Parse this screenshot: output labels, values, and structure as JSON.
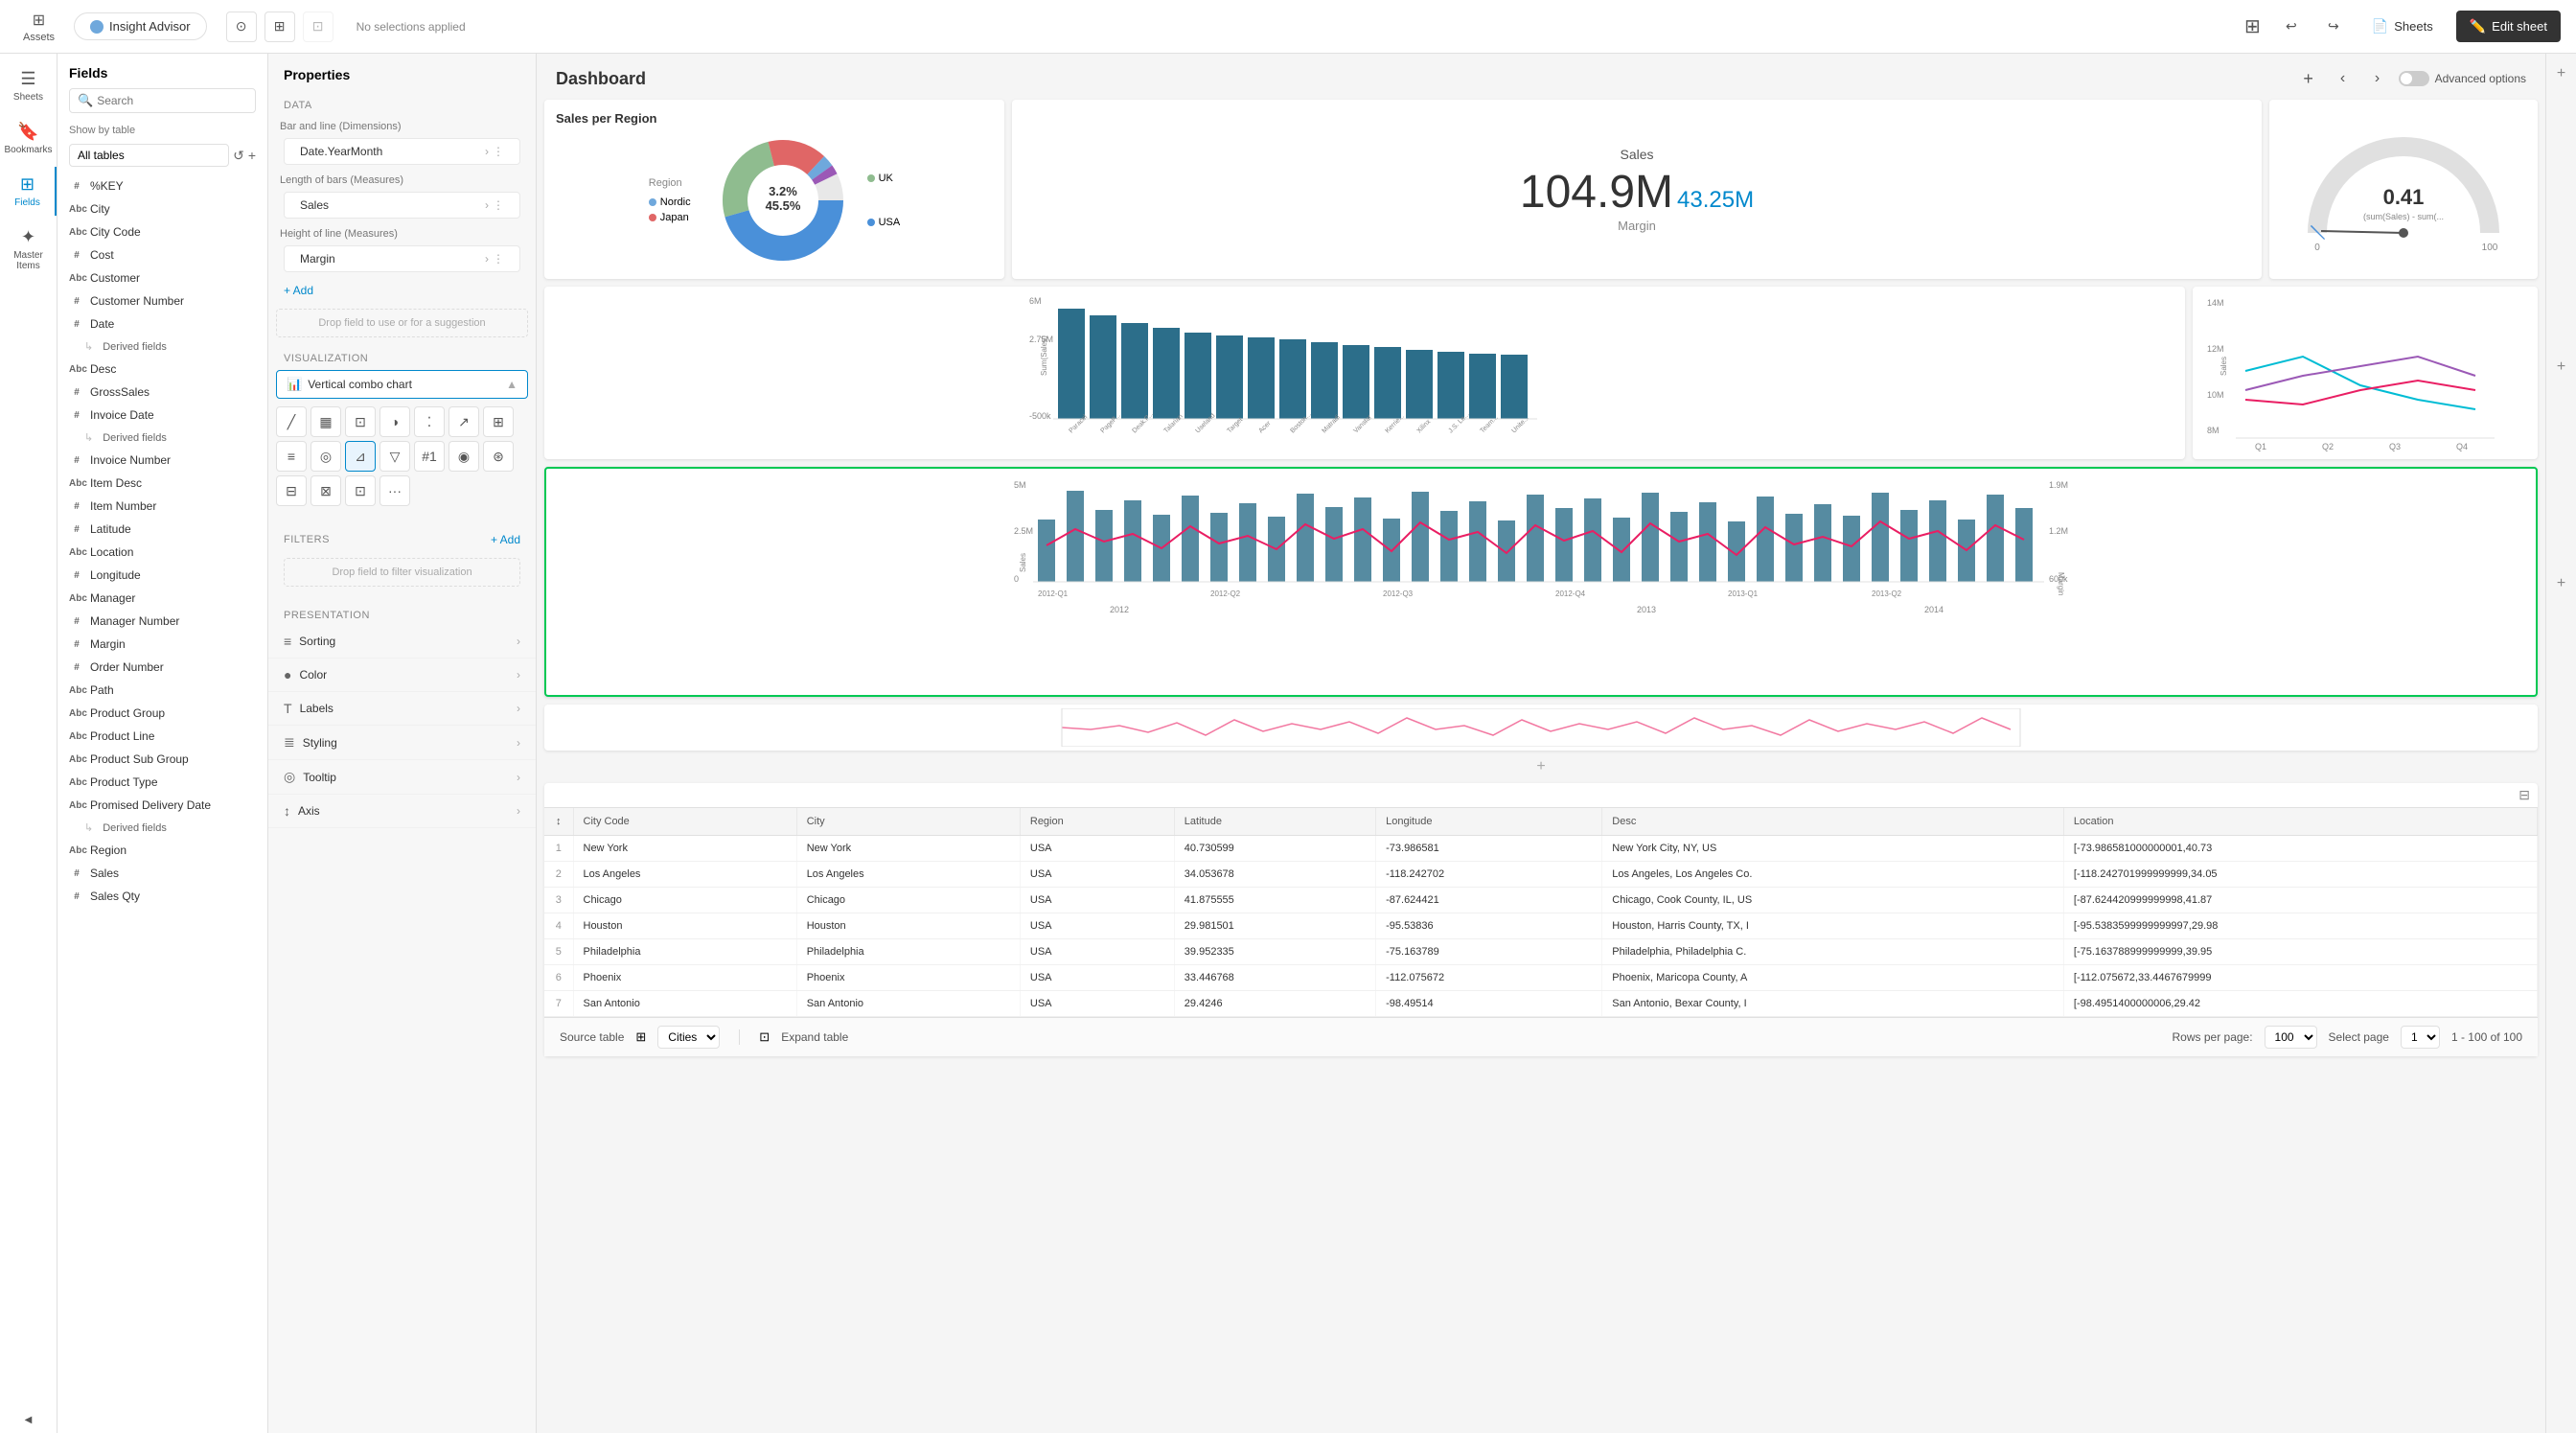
{
  "topbar": {
    "assets_label": "Assets",
    "insight_advisor_label": "Insight Advisor",
    "no_selections": "No selections applied",
    "sheets_label": "Sheets",
    "edit_sheet_label": "Edit sheet"
  },
  "sidebar": {
    "items": [
      {
        "label": "Sheets",
        "icon": "☰"
      },
      {
        "label": "Bookmarks",
        "icon": "🔖"
      },
      {
        "label": "Fields",
        "icon": "⊞"
      },
      {
        "label": "Master Items",
        "icon": "✦"
      }
    ]
  },
  "fields_panel": {
    "title": "Fields",
    "search_placeholder": "Search",
    "show_by_table_label": "Show by table",
    "table_value": "All tables",
    "fields": [
      {
        "type": "#",
        "name": "%KEY"
      },
      {
        "type": "Abc",
        "name": "City"
      },
      {
        "type": "Abc",
        "name": "City Code"
      },
      {
        "type": "#",
        "name": "Cost"
      },
      {
        "type": "Abc",
        "name": "Customer"
      },
      {
        "type": "#",
        "name": "Customer Number"
      },
      {
        "type": "#",
        "name": "Date"
      },
      {
        "type": "sub",
        "name": "Derived fields"
      },
      {
        "type": "Abc",
        "name": "Desc"
      },
      {
        "type": "#",
        "name": "GrossSales"
      },
      {
        "type": "#",
        "name": "Invoice Date"
      },
      {
        "type": "sub",
        "name": "Derived fields"
      },
      {
        "type": "#",
        "name": "Invoice Number"
      },
      {
        "type": "Abc",
        "name": "Item Desc"
      },
      {
        "type": "#",
        "name": "Item Number"
      },
      {
        "type": "#",
        "name": "Latitude"
      },
      {
        "type": "Abc",
        "name": "Location"
      },
      {
        "type": "#",
        "name": "Longitude"
      },
      {
        "type": "Abc",
        "name": "Manager"
      },
      {
        "type": "#",
        "name": "Manager Number"
      },
      {
        "type": "#",
        "name": "Margin"
      },
      {
        "type": "#",
        "name": "Order Number"
      },
      {
        "type": "Abc",
        "name": "Path"
      },
      {
        "type": "Abc",
        "name": "Product Group"
      },
      {
        "type": "Abc",
        "name": "Product Line"
      },
      {
        "type": "Abc",
        "name": "Product Sub Group"
      },
      {
        "type": "Abc",
        "name": "Product Type"
      },
      {
        "type": "Abc",
        "name": "Promised Delivery Date"
      },
      {
        "type": "sub",
        "name": "Derived fields"
      },
      {
        "type": "Abc",
        "name": "Region"
      },
      {
        "type": "#",
        "name": "Sales"
      },
      {
        "type": "#",
        "name": "Sales Qty"
      }
    ]
  },
  "properties_panel": {
    "title": "Properties",
    "data_section": "Data",
    "bar_line_label": "Bar and line (Dimensions)",
    "bar_dim_value": "Date.YearMonth",
    "length_bars_label": "Length of bars (Measures)",
    "length_bars_value": "Sales",
    "height_line_label": "Height of line (Measures)",
    "height_line_value": "Margin",
    "add_label": "+ Add",
    "drop_hint": "Drop field to use or for a suggestion",
    "visualization_label": "Visualization",
    "viz_selected": "Vertical combo chart",
    "filters_label": "Filters",
    "add_filter_label": "+ Add",
    "drop_filter_hint": "Drop field to filter visualization",
    "presentation_label": "Presentation",
    "pres_items": [
      {
        "icon": "≡",
        "label": "Sorting"
      },
      {
        "icon": "●",
        "label": "Color"
      },
      {
        "icon": "T",
        "label": "Labels"
      },
      {
        "icon": "≣",
        "label": "Styling"
      },
      {
        "icon": "◎",
        "label": "Tooltip"
      },
      {
        "icon": "↕",
        "label": "Axis"
      }
    ]
  },
  "dashboard": {
    "title": "Dashboard",
    "advanced_options": "Advanced options",
    "charts": {
      "donut": {
        "title": "Sales per Region",
        "legend_label": "Region",
        "segments": [
          {
            "label": "Nordic",
            "color": "#6fa8dc",
            "pct": "3.2%"
          },
          {
            "label": "Japan",
            "color": "#e06666",
            "pct": ""
          },
          {
            "label": "UK",
            "color": "#8fbc8f",
            "pct": ""
          },
          {
            "label": "USA",
            "color": "#4a90d9",
            "pct": ""
          }
        ],
        "center_pct": "45.5%"
      },
      "sales_kpi": {
        "label": "Sales",
        "value": "104.9M",
        "sub_value": "43.25M",
        "sub_label": "Margin"
      },
      "gauge": {
        "value": "0.41",
        "sub_label": "(sum(Sales) - sum(...",
        "min": "0",
        "max": "100"
      }
    },
    "table": {
      "columns": [
        "City Code",
        "City",
        "Region",
        "Latitude",
        "Longitude",
        "Desc",
        "Location"
      ],
      "rows": [
        {
          "num": "1",
          "city_code": "New York",
          "city": "New York",
          "region": "USA",
          "lat": "40.730599",
          "lon": "-73.986581",
          "desc": "New York City, NY, US",
          "loc": "[-73.986581000000001,40.73"
        },
        {
          "num": "2",
          "city_code": "Los Angeles",
          "city": "Los Angeles",
          "region": "USA",
          "lat": "34.053678",
          "lon": "-118.242702",
          "desc": "Los Angeles, Los Angeles Co.",
          "loc": "[-118.242701999999999,34.05"
        },
        {
          "num": "3",
          "city_code": "Chicago",
          "city": "Chicago",
          "region": "USA",
          "lat": "41.875555",
          "lon": "-87.624421",
          "desc": "Chicago, Cook County, IL, US",
          "loc": "[-87.624420999999998,41.87"
        },
        {
          "num": "4",
          "city_code": "Houston",
          "city": "Houston",
          "region": "USA",
          "lat": "29.981501",
          "lon": "-95.53836",
          "desc": "Houston, Harris County, TX, I",
          "loc": "[-95.5383599999999997,29.98"
        },
        {
          "num": "5",
          "city_code": "Philadelphia",
          "city": "Philadelphia",
          "region": "USA",
          "lat": "39.952335",
          "lon": "-75.163789",
          "desc": "Philadelphia, Philadelphia C.",
          "loc": "[-75.163788999999999,39.95"
        },
        {
          "num": "6",
          "city_code": "Phoenix",
          "city": "Phoenix",
          "region": "USA",
          "lat": "33.446768",
          "lon": "-112.075672",
          "desc": "Phoenix, Maricopa County, A",
          "loc": "[-112.075672,33.4467679999"
        },
        {
          "num": "7",
          "city_code": "San Antonio",
          "city": "San Antonio",
          "region": "USA",
          "lat": "29.4246",
          "lon": "-98.49514",
          "desc": "San Antonio, Bexar County, I",
          "loc": "[-98.4951400000006,29.42"
        }
      ],
      "source_label": "Source table",
      "source_value": "Cities",
      "expand_label": "Expand table",
      "rows_per_page_label": "Rows per page:",
      "rows_per_page_value": "100",
      "select_page_label": "Select page",
      "select_page_value": "1",
      "page_info": "1 - 100 of 100"
    }
  }
}
